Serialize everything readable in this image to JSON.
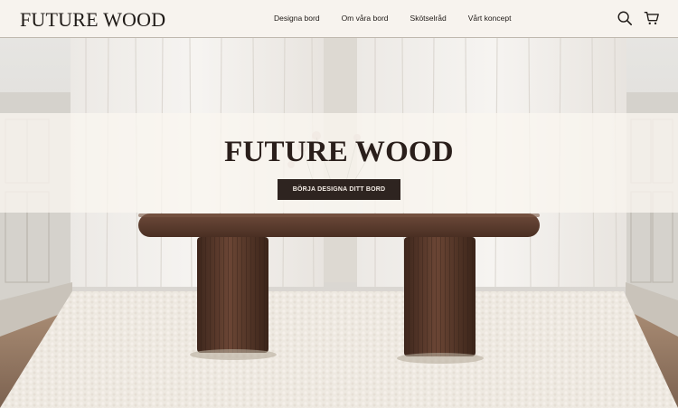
{
  "header": {
    "logo": "FUTURE WOOD",
    "nav": [
      {
        "label": "Designa bord"
      },
      {
        "label": "Om våra bord"
      },
      {
        "label": "Skötselråd"
      },
      {
        "label": "Vårt koncept"
      }
    ],
    "icons": [
      "search-icon",
      "cart-icon"
    ]
  },
  "hero": {
    "title": "FUTURE WOOD",
    "cta_label": "BÖRJA DESIGNA DITT BORD"
  },
  "colors": {
    "header_bg": "#f7f3ee",
    "text": "#1f1a17",
    "cta_bg": "#2e2420",
    "cta_text": "#f4ede6",
    "table_wood": "#5a3a2c"
  }
}
